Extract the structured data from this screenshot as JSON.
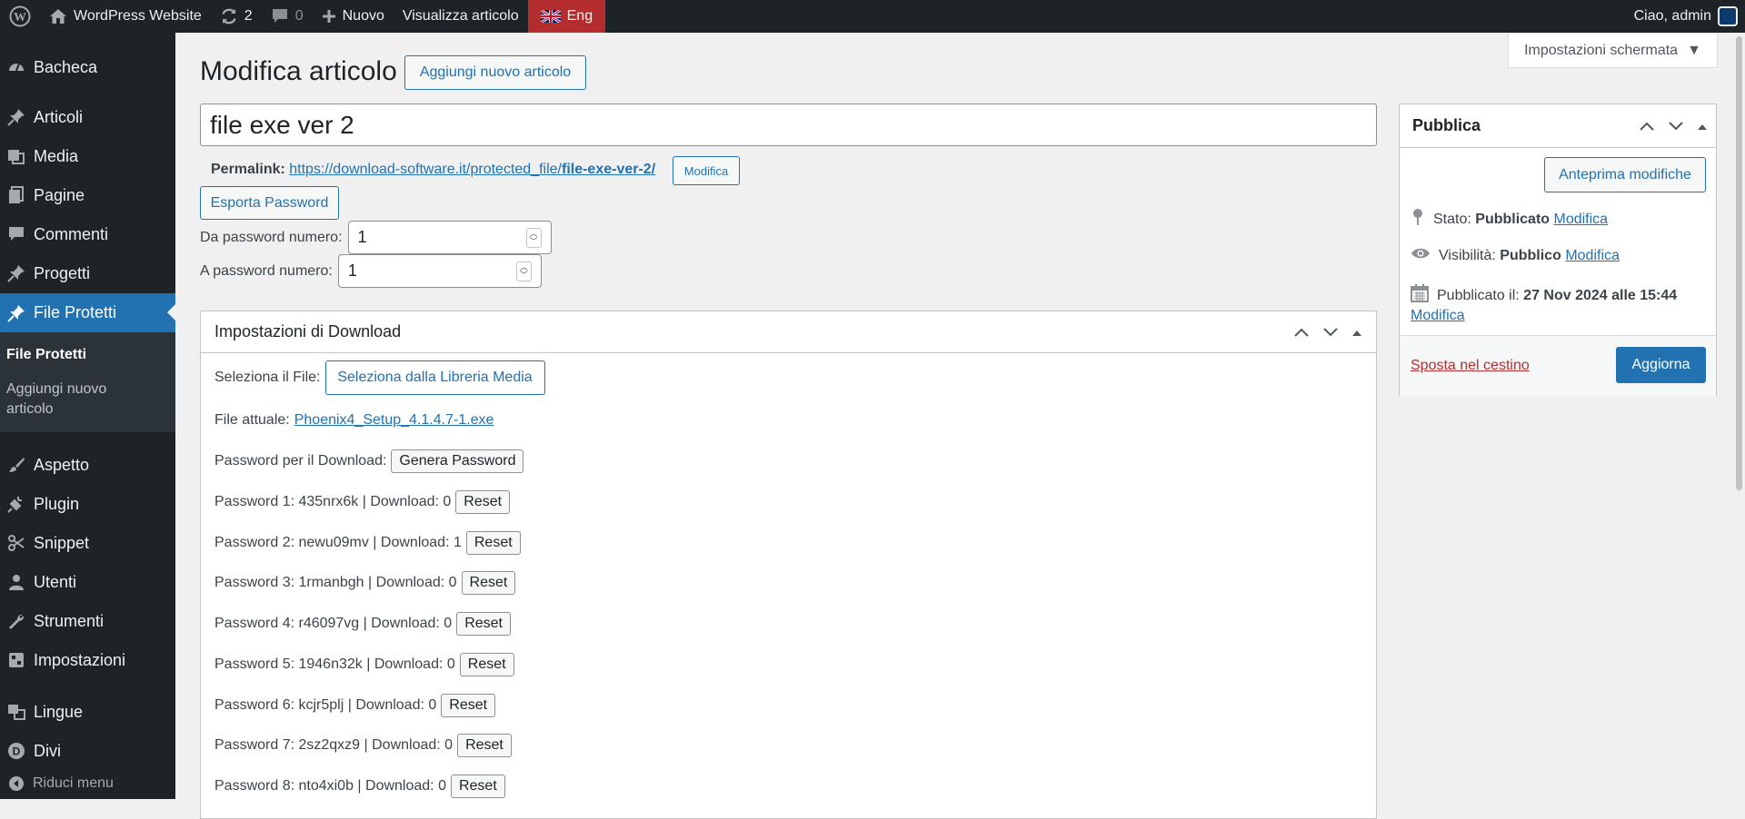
{
  "adminbar": {
    "site_name": "WordPress Website",
    "updates_count": "2",
    "comments_count": "0",
    "new_label": "Nuovo",
    "view_post_label": "Visualizza articolo",
    "language_label": "Eng",
    "greeting": "Ciao, admin"
  },
  "sidebar": {
    "items": [
      {
        "label": "Bacheca",
        "icon": "dashboard-icon"
      },
      {
        "label": "Articoli",
        "icon": "pin-icon"
      },
      {
        "label": "Media",
        "icon": "media-icon"
      },
      {
        "label": "Pagine",
        "icon": "pages-icon"
      },
      {
        "label": "Commenti",
        "icon": "comments-icon"
      },
      {
        "label": "Progetti",
        "icon": "pin-icon"
      },
      {
        "label": "File Protetti",
        "icon": "pin-icon"
      },
      {
        "label": "Aspetto",
        "icon": "brush-icon"
      },
      {
        "label": "Plugin",
        "icon": "plugin-icon"
      },
      {
        "label": "Snippet",
        "icon": "scissors-icon"
      },
      {
        "label": "Utenti",
        "icon": "user-icon"
      },
      {
        "label": "Strumenti",
        "icon": "wrench-icon"
      },
      {
        "label": "Impostazioni",
        "icon": "settings-icon"
      },
      {
        "label": "Lingue",
        "icon": "translation-icon"
      },
      {
        "label": "Divi",
        "icon": "divi-icon"
      }
    ],
    "submenu_current": "File Protetti",
    "submenu_add": "Aggiungi nuovo articolo",
    "collapse_label": "Riduci menu"
  },
  "page": {
    "title": "Modifica articolo",
    "add_new_label": "Aggiungi nuovo articolo",
    "screen_options_label": "Impostazioni schermata",
    "post_title": "file exe ver 2",
    "permalink_label": "Permalink:",
    "permalink_base": "https://download-software.it/protected_file/",
    "permalink_slug": "file-exe-ver-2/",
    "permalink_edit": "Modifica",
    "export_password_label": "Esporta Password",
    "from_password_label": "Da password numero:",
    "from_password_value": "1",
    "to_password_label": "A password numero:",
    "to_password_value": "1"
  },
  "download_box": {
    "title": "Impostazioni di Download",
    "select_file_label": "Seleziona il File:",
    "select_media_button": "Seleziona dalla Libreria Media",
    "current_file_label": "File attuale:",
    "current_file_name": "Phoenix4_Setup_4.1.4.7-1.exe",
    "password_label": "Password per il Download:",
    "generate_button": "Genera Password",
    "reset_label": "Reset",
    "passwords": [
      "Password 1: 435nrx6k | Download: 0",
      "Password 2: newu09mv | Download: 1",
      "Password 3: 1rmanbgh | Download: 0",
      "Password 4: r46097vg | Download: 0",
      "Password 5: 1946n32k | Download: 0",
      "Password 6: kcjr5plj | Download: 0",
      "Password 7: 2sz2qxz9 | Download: 0",
      "Password 8: nto4xi0b | Download: 0"
    ]
  },
  "publish_box": {
    "title": "Pubblica",
    "preview_button": "Anteprima modifiche",
    "status_label": "Stato:",
    "status_value": "Pubblicato",
    "visibility_label": "Visibilità:",
    "visibility_value": "Pubblico",
    "published_label": "Pubblicato il:",
    "published_value": "27 Nov 2024 alle 15:44",
    "edit_link": "Modifica",
    "trash_link": "Sposta nel cestino",
    "update_button": "Aggiorna"
  }
}
